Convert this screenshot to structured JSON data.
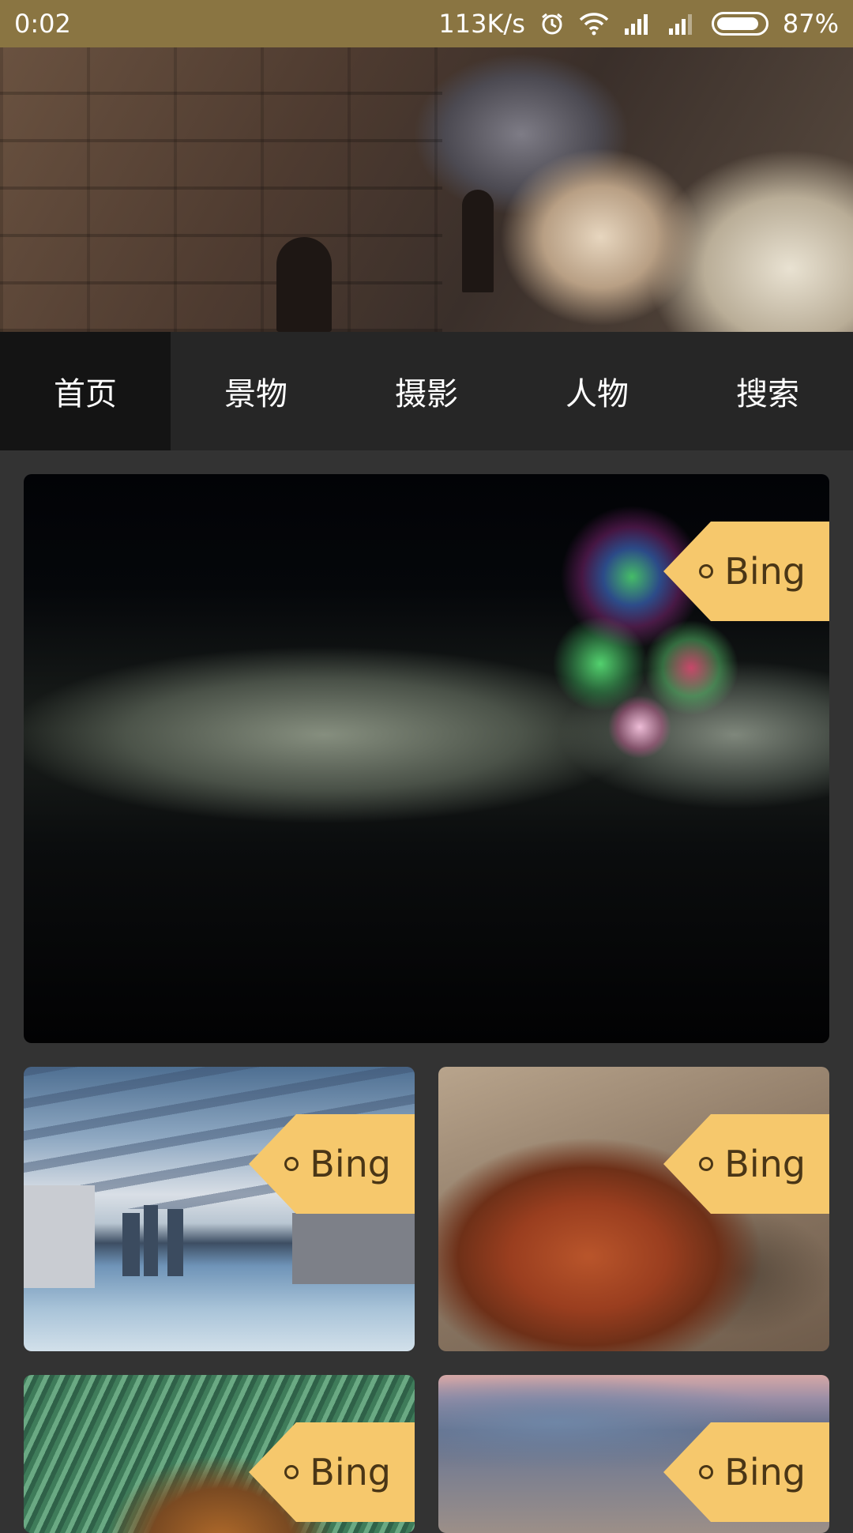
{
  "status_bar": {
    "time": "0:02",
    "network_speed": "113K/s",
    "battery_percent": "87%",
    "battery_level": 0.87,
    "icons": [
      "alarm-icon",
      "wifi-icon",
      "signal-icon",
      "signal-icon",
      "battery-icon"
    ]
  },
  "tabs": [
    {
      "label": "首页",
      "active": true
    },
    {
      "label": "景物",
      "active": false
    },
    {
      "label": "摄影",
      "active": false
    },
    {
      "label": "人物",
      "active": false
    },
    {
      "label": "搜索",
      "active": false
    }
  ],
  "cards": [
    {
      "source": "Bing"
    },
    {
      "source": "Bing"
    },
    {
      "source": "Bing"
    },
    {
      "source": "Bing"
    },
    {
      "source": "Bing"
    }
  ],
  "colors": {
    "status_bar": "#8a7542",
    "tab_bar": "#262626",
    "tab_active": "#141414",
    "background": "#333333",
    "tag": "#f6c86c",
    "tag_text": "#4a3616"
  }
}
